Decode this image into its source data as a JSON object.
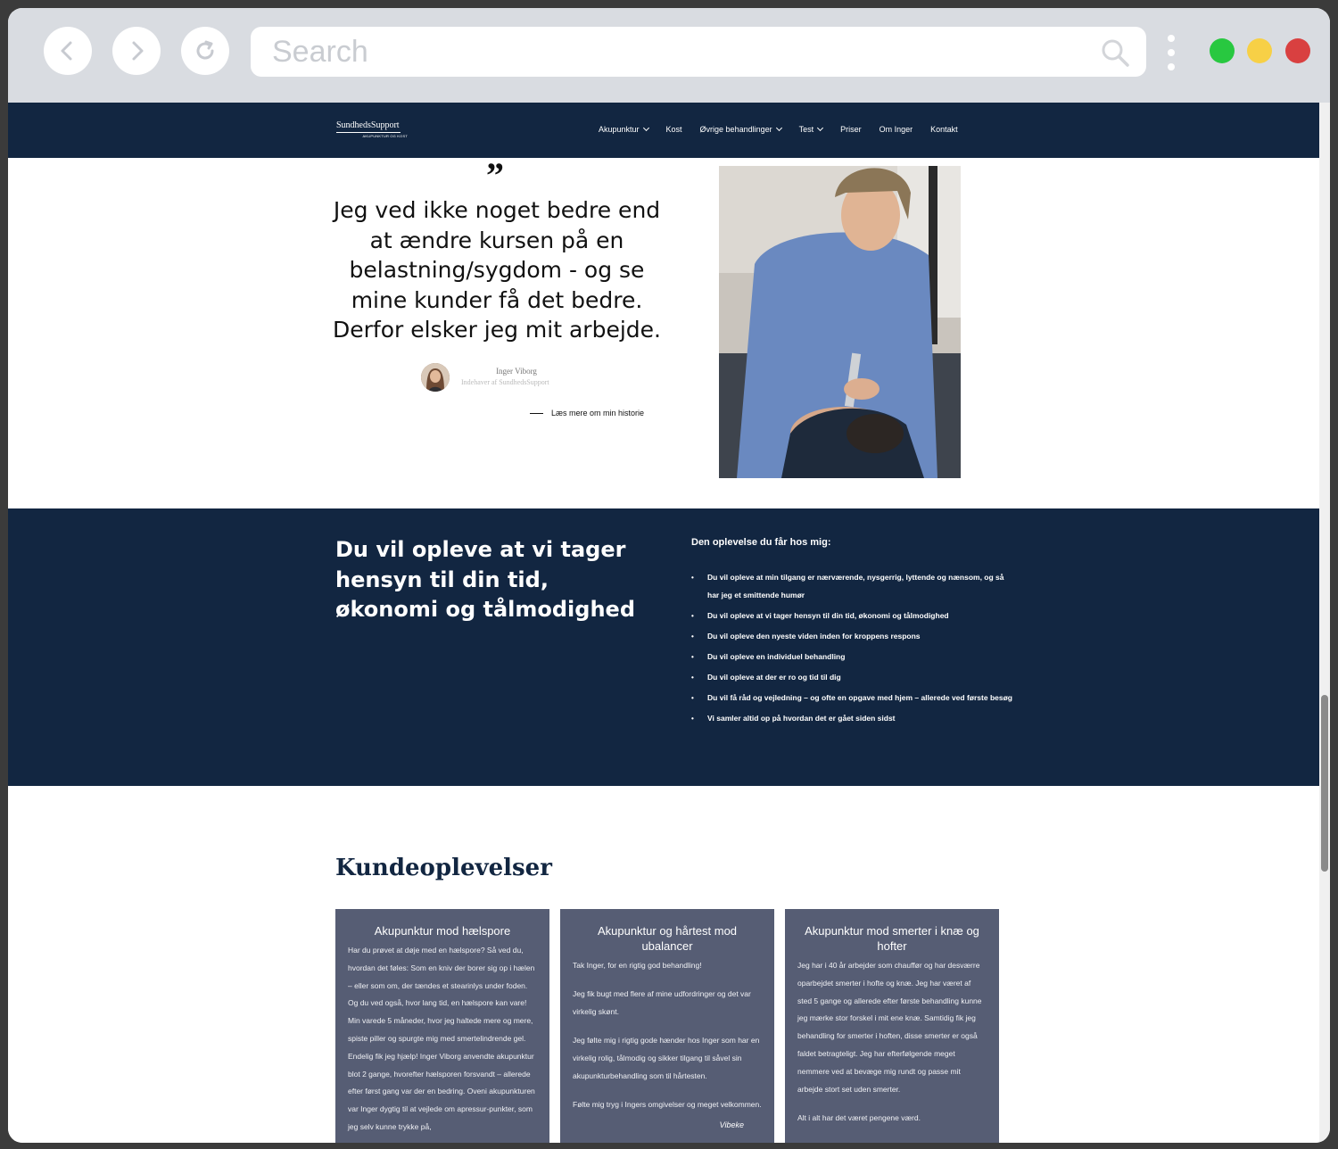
{
  "browser": {
    "search_placeholder": "Search",
    "traffic_lights": [
      "#28c840",
      "#f7d046",
      "#d94040"
    ]
  },
  "header": {
    "logo": {
      "title": "SundhedsSupport",
      "subtitle": "AKUPUNKTUR OG KOST"
    },
    "menu": [
      {
        "label": "Akupunktur",
        "dropdown": true
      },
      {
        "label": "Kost",
        "dropdown": false
      },
      {
        "label": "Øvrige behandlinger",
        "dropdown": true
      },
      {
        "label": "Test",
        "dropdown": true
      },
      {
        "label": "Priser",
        "dropdown": false
      },
      {
        "label": "Om Inger",
        "dropdown": false
      },
      {
        "label": "Kontakt",
        "dropdown": false
      }
    ]
  },
  "quote": {
    "mark": "”",
    "text": "Jeg ved ikke noget bedre end at ændre kursen på en belastning/sygdom - og se mine kunder få det bedre. Derfor elsker jeg mit arbejde.",
    "author_name": "Inger Viborg",
    "author_role": "Indehaver af SundhedsSupport",
    "read_more": "Læs mere om min historie"
  },
  "experience": {
    "heading": "Du vil opleve at vi tager hensyn til din tid, økonomi og tålmodighed",
    "list_title": "Den oplevelse du får hos mig:",
    "items": [
      "Du vil opleve at min tilgang er nærværende, nysgerrig, lyttende og  nænsom, og så har jeg et smittende humør",
      "Du vil opleve at vi tager hensyn til din tid, økonomi og tålmodighed",
      "Du vil opleve den nyeste viden inden for kroppens respons",
      "Du vil opleve en individuel behandling",
      "Du vil opleve at der er ro og tid til dig",
      "Du vil få råd og vejledning – og ofte en opgave med hjem – allerede ved første besøg",
      "Vi samler altid op på hvordan det er gået siden sidst"
    ]
  },
  "testimonials": {
    "heading": "Kundeoplevelser",
    "cards": [
      {
        "title": "Akupunktur mod hælspore",
        "paragraphs": [
          "Har du prøvet at døje med en hælspore? Så ved du, hvordan det føles: Som en kniv der borer sig op i hælen – eller som om, der tændes et stearinlys under foden. Og du ved også, hvor lang tid, en hælspore kan vare! Min varede 5 måneder, hvor jeg haltede mere og mere, spiste piller og spurgte mig med smertelindrende gel. Endelig fik jeg hjælp! Inger Viborg anvendte akupunktur blot 2 gange, hvorefter hælsporen forsvandt – allerede efter først gang var der en bedring. Oveni akupunkturen var Inger dygtig til at vejlede om apressur-punkter, som jeg selv kunne trykke på,"
        ],
        "signature": ""
      },
      {
        "title": "Akupunktur og hårtest mod ubalancer",
        "paragraphs": [
          "Tak Inger, for en rigtig god behandling!",
          "Jeg fik bugt med flere af mine udfordringer og det var virkelig skønt.",
          "Jeg følte mig i rigtig gode hænder hos Inger som har en virkelig rolig, tålmodig og sikker tilgang til såvel sin akupunkturbehandling som til hårtesten.",
          "Følte mig tryg i Ingers omgivelser og meget velkommen."
        ],
        "signature": "Vibeke"
      },
      {
        "title": "Akupunktur mod smerter i knæ og hofter",
        "paragraphs": [
          "Jeg har i 40 år arbejder som chauffør og har desværre oparbejdet smerter i hofte og knæ. Jeg har været af sted 5 gange og allerede efter første behandling kunne jeg mærke stor forskel i mit ene knæ. Samtidig fik jeg behandling for smerter i hoften, disse smerter er også faldet betragteligt. Jeg har efterfølgende meget nemmere ved at bevæge mig rundt og passe mit arbejde stort set uden smerter.",
          "Alt i alt har det været pengene værd."
        ],
        "signature": ""
      }
    ]
  }
}
